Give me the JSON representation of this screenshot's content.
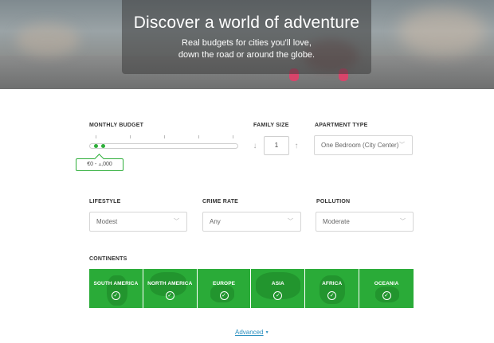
{
  "hero": {
    "title": "Discover a world of adventure",
    "subtitle_line1": "Real budgets for cities you'll love,",
    "subtitle_line2": "down the road or around the globe."
  },
  "budget": {
    "label": "MONTHLY BUDGET",
    "range_text": "€0 - 1,000",
    "selected_range": [
      0,
      0
    ]
  },
  "family": {
    "label": "FAMILY SIZE",
    "value": "1",
    "decrement_icon": "arrow-down-icon",
    "increment_icon": "arrow-up-icon"
  },
  "apartment": {
    "label": "APARTMENT TYPE",
    "value": "One Bedroom (City Center)"
  },
  "lifestyle": {
    "label": "LIFESTYLE",
    "value": "Modest"
  },
  "crime": {
    "label": "CRIME RATE",
    "value": "Any"
  },
  "pollution": {
    "label": "POLLUTION",
    "value": "Moderate"
  },
  "continents": {
    "label": "CONTINENTS",
    "items": [
      {
        "name": "SOUTH AMERICA",
        "checked": true
      },
      {
        "name": "NORTH AMERICA",
        "checked": true
      },
      {
        "name": "EUROPE",
        "checked": true
      },
      {
        "name": "ASIA",
        "checked": true
      },
      {
        "name": "AFRICA",
        "checked": true
      },
      {
        "name": "OCEANIA",
        "checked": true
      }
    ],
    "check_glyph": "✓",
    "color": "#2aab38"
  },
  "advanced": {
    "label": "Advanced",
    "caret": "▼"
  },
  "colors": {
    "accent": "#2eae3a",
    "link": "#2a8fbf"
  }
}
